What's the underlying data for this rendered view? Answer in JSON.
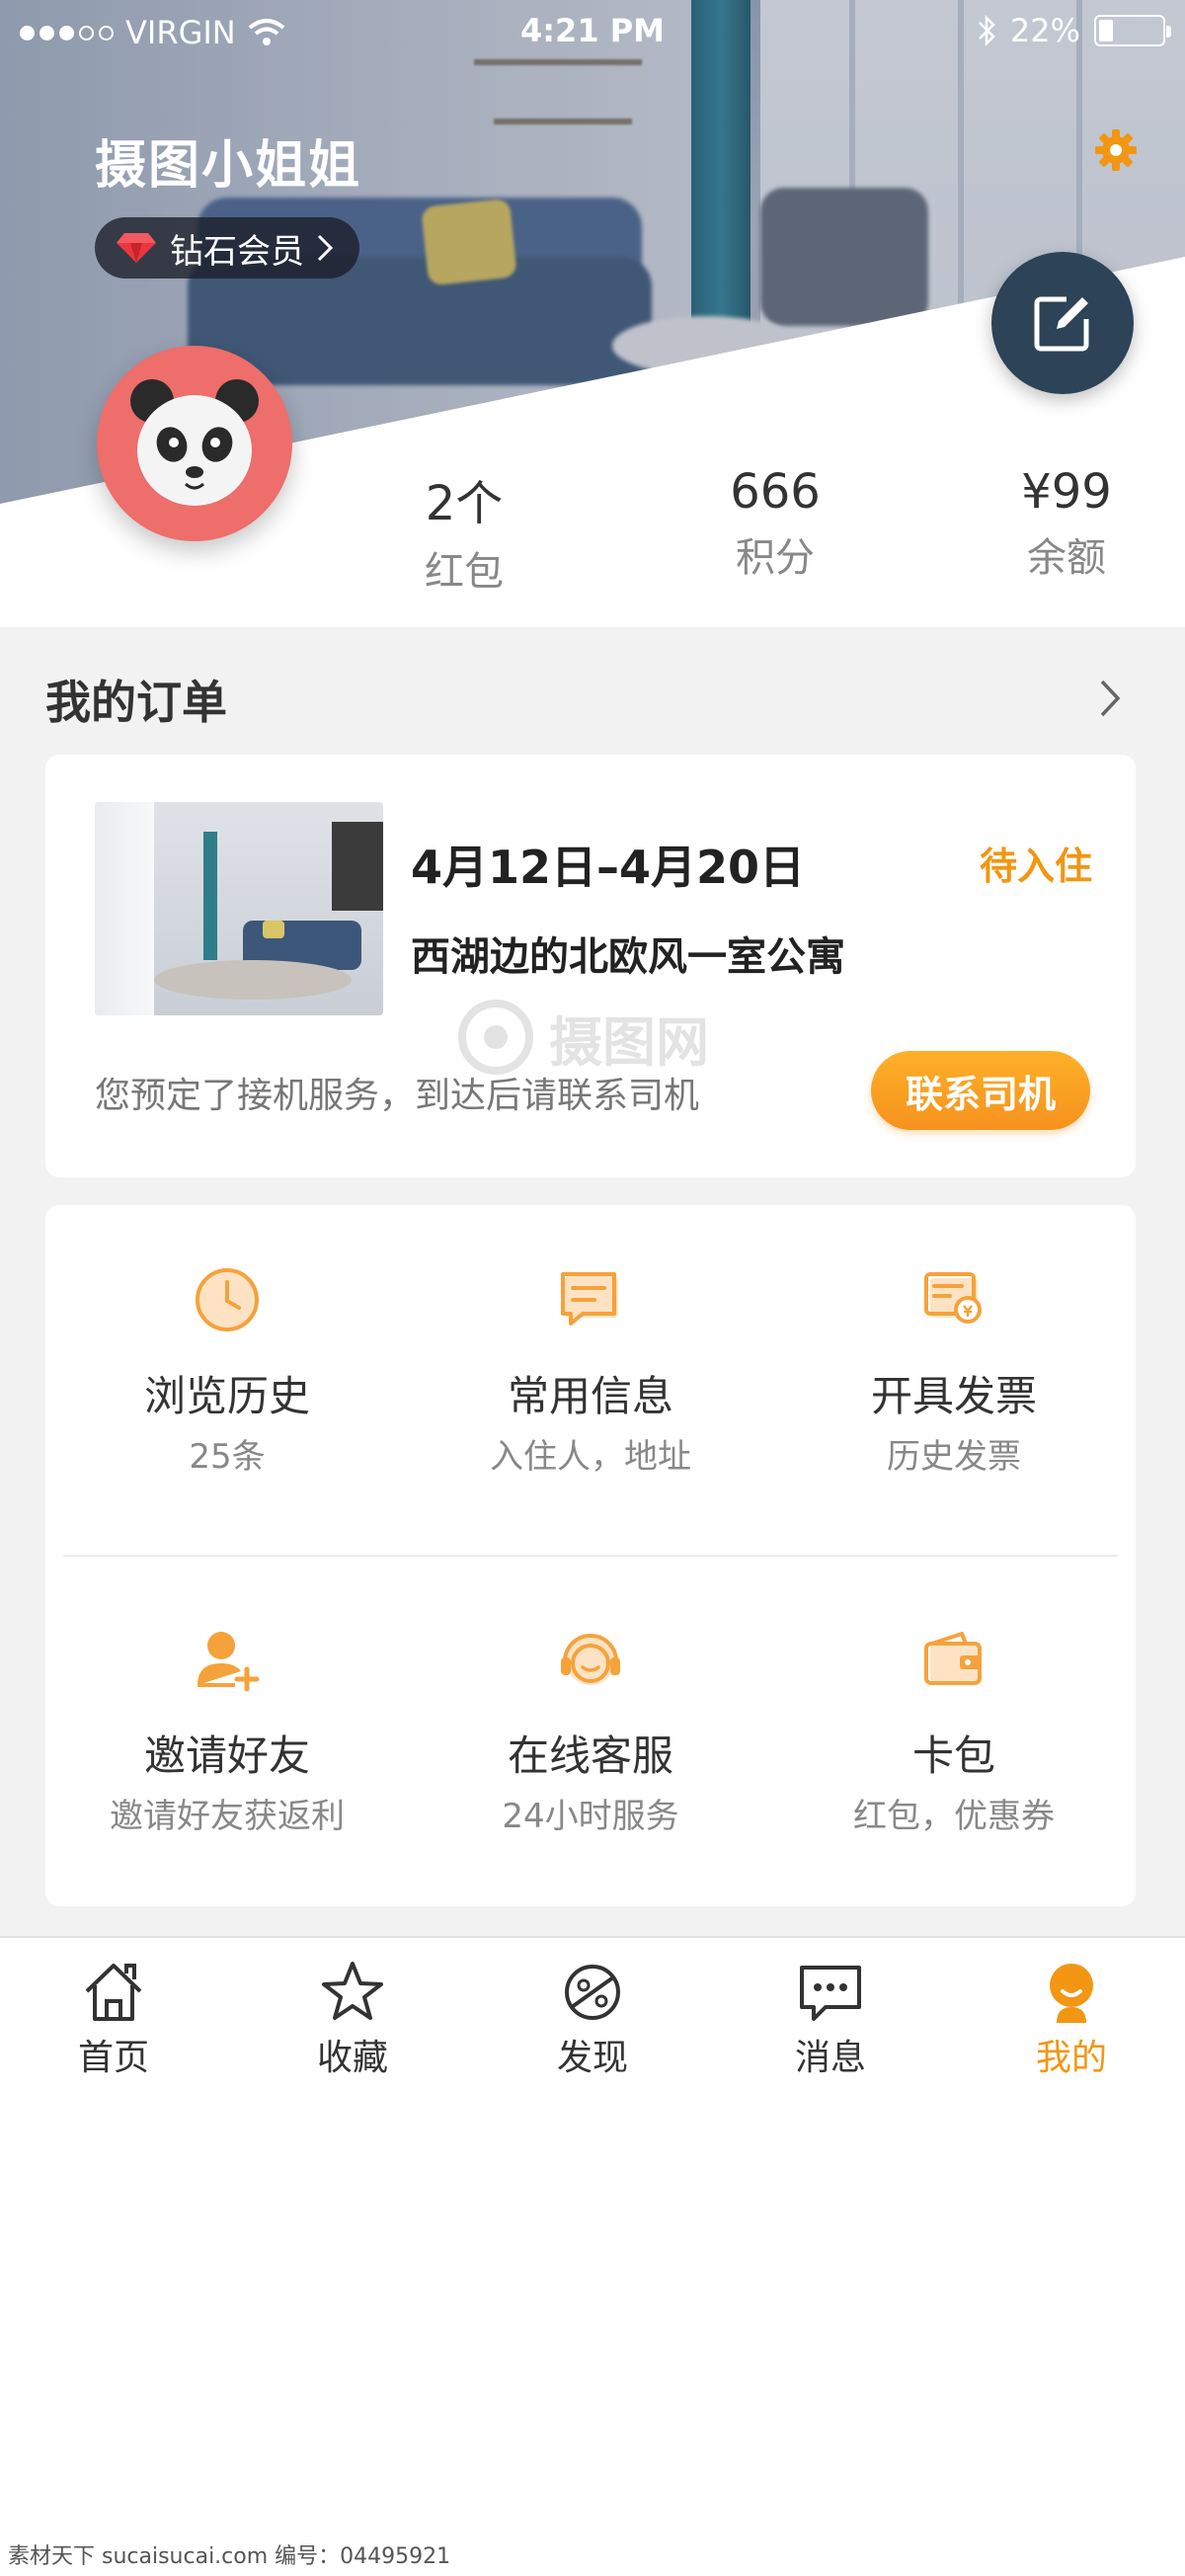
{
  "status_bar": {
    "carrier": "VIRGIN",
    "time": "4:21 PM",
    "battery": "22%",
    "battery_level": 0.22
  },
  "profile": {
    "username": "摄图小姐姐",
    "membership": "钻石会员",
    "avatar_icon": "panda-icon",
    "stats": [
      {
        "value": "2个",
        "label": "红包"
      },
      {
        "value": "666",
        "label": "积分"
      },
      {
        "value": "¥99",
        "label": "余额"
      }
    ]
  },
  "orders": {
    "title": "我的订单",
    "order": {
      "dates": "4月12日–4月20日",
      "status": "待入住",
      "name": "西湖边的北欧风一室公寓",
      "note": "您预定了接机服务，到达后请联系司机",
      "action": "联系司机"
    }
  },
  "services": [
    {
      "title": "浏览历史",
      "subtitle": "25条",
      "icon": "clock-icon"
    },
    {
      "title": "常用信息",
      "subtitle": "入住人，地址",
      "icon": "message-card-icon"
    },
    {
      "title": "开具发票",
      "subtitle": "历史发票",
      "icon": "invoice-icon"
    },
    {
      "title": "邀请好友",
      "subtitle": "邀请好友获返利",
      "icon": "add-user-icon"
    },
    {
      "title": "在线客服",
      "subtitle": "24小时服务",
      "icon": "headset-icon"
    },
    {
      "title": "卡包",
      "subtitle": "红包，优惠券",
      "icon": "wallet-icon"
    }
  ],
  "tabbar": [
    {
      "label": "首页",
      "icon": "home-icon"
    },
    {
      "label": "收藏",
      "icon": "star-icon"
    },
    {
      "label": "发现",
      "icon": "planet-icon"
    },
    {
      "label": "消息",
      "icon": "chat-icon"
    },
    {
      "label": "我的",
      "icon": "user-icon",
      "active": true
    }
  ],
  "watermark": "摄图网",
  "footer": "素材天下 sucaisucai.com  编号：04495921",
  "colors": {
    "accent": "#f29613",
    "fab": "#2d4357",
    "avatar_bg": "#ed6e6b"
  }
}
